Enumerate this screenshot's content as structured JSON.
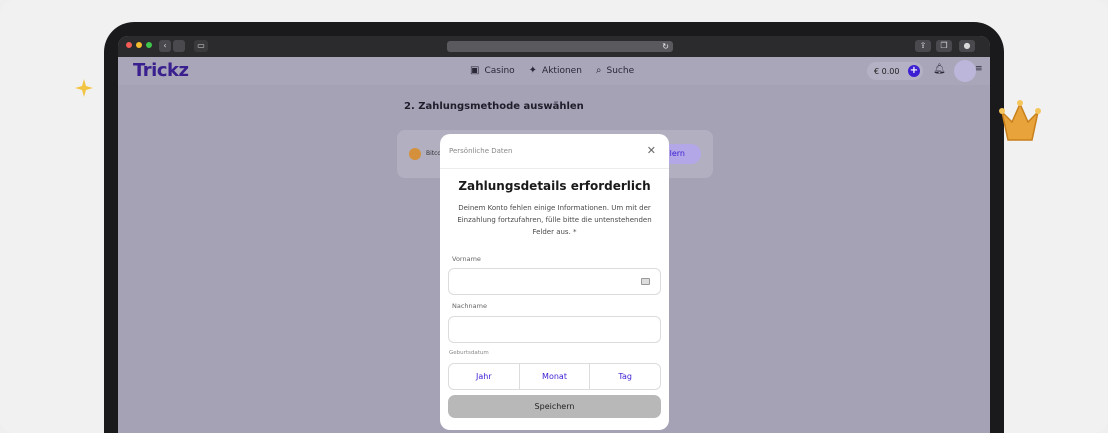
{
  "browser": {
    "traffic_lights": [
      "#f25c54",
      "#f5bb2e",
      "#3ec74b"
    ]
  },
  "header": {
    "logo": "Trickz",
    "nav": [
      {
        "icon": "casino-icon",
        "label": "Casino"
      },
      {
        "icon": "sparkle-icon",
        "label": "Aktionen"
      },
      {
        "icon": "search-icon",
        "label": "Suche"
      }
    ],
    "balance": "€ 0.00",
    "plus": "+"
  },
  "page": {
    "step_title": "2. Zahlungsmethode auswählen",
    "method_name": "Bitco",
    "method_button": "lern"
  },
  "modal": {
    "header_title": "Persönliche Daten",
    "close": "✕",
    "title": "Zahlungsdetails erforderlich",
    "description": "Deinem Konto fehlen einige Informationen. Um mit der Einzahlung fortzufahren, fülle bitte die untenstehenden Felder aus. *",
    "first_name_label": "Vorname",
    "first_name_value": "",
    "last_name_label": "Nachname",
    "last_name_value": "",
    "birthdate_label": "Geburtsdatum",
    "year": "Jahr",
    "month": "Monat",
    "day": "Tag",
    "save": "Speichern"
  },
  "colors": {
    "accent": "#3b1fd2",
    "logo": "#3a1f8f",
    "overlay": "#a5a2b6"
  }
}
